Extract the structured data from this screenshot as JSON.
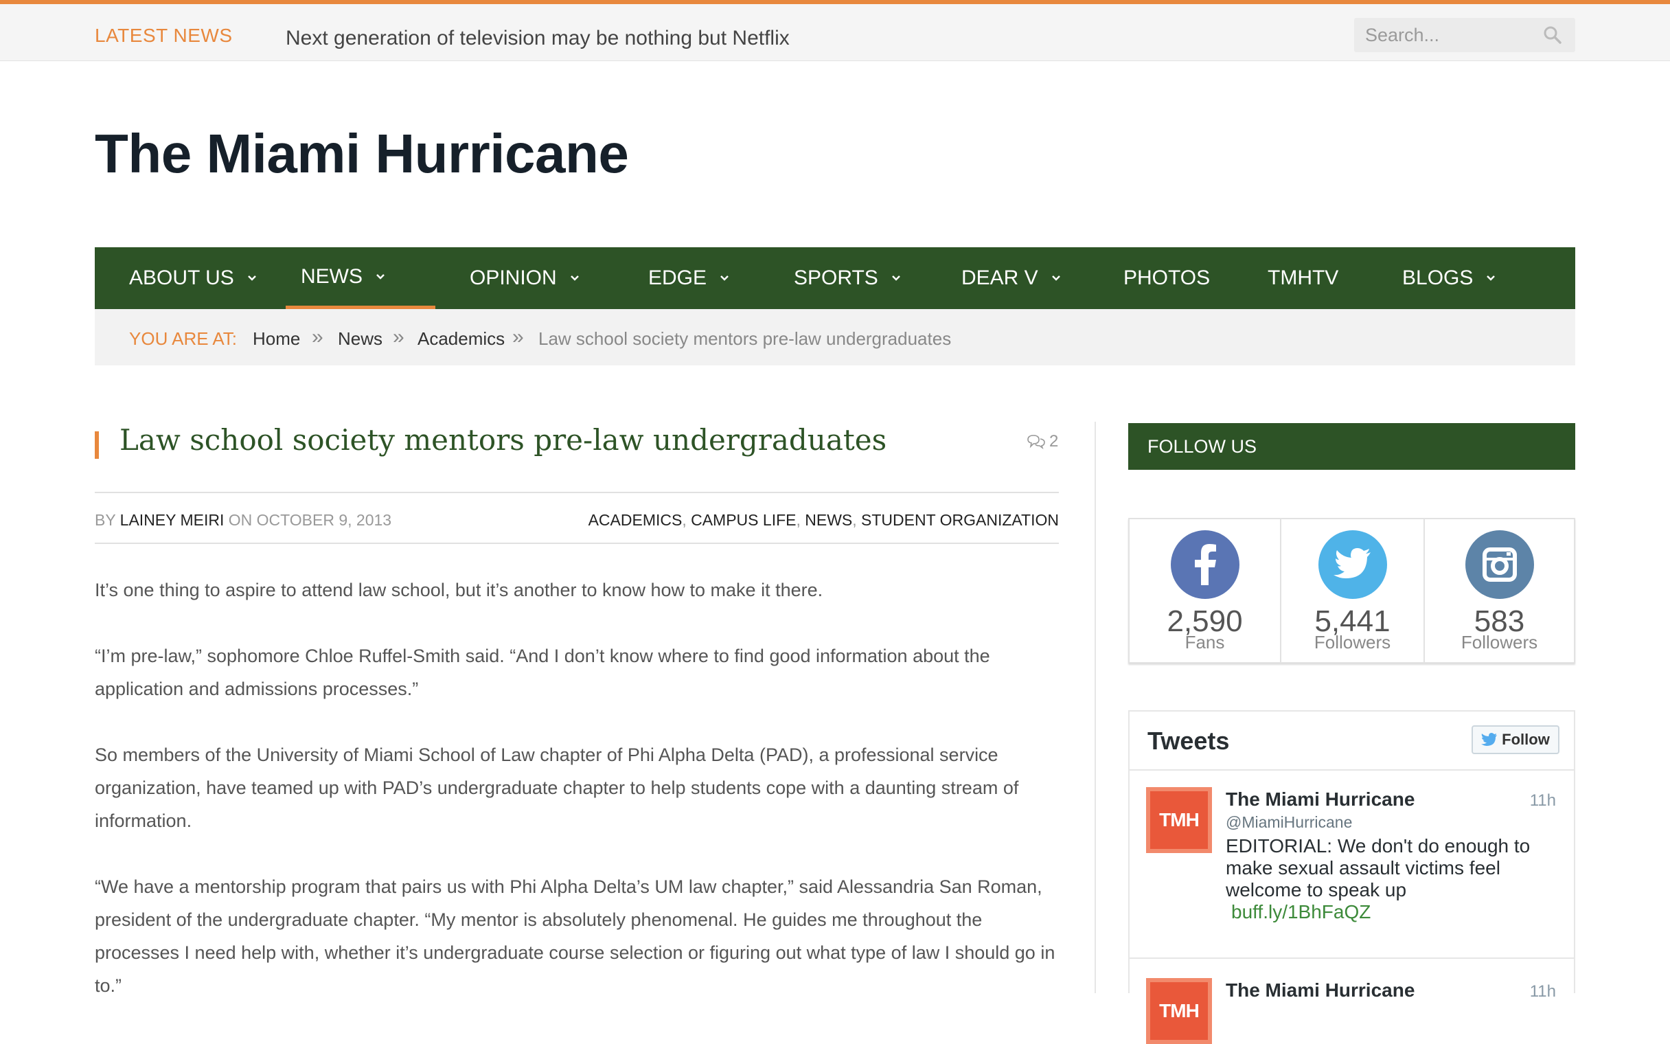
{
  "topbar": {
    "latest_label": "LATEST NEWS",
    "ticker": "Next generation of television may be nothing but Netflix",
    "search_placeholder": "Search..."
  },
  "site_title": "The Miami Hurricane",
  "nav": {
    "items": [
      {
        "label": "ABOUT US",
        "dropdown": true
      },
      {
        "label": "NEWS",
        "dropdown": true,
        "active": true
      },
      {
        "label": "OPINION",
        "dropdown": true
      },
      {
        "label": "EDGE",
        "dropdown": true
      },
      {
        "label": "SPORTS",
        "dropdown": true
      },
      {
        "label": "DEAR V",
        "dropdown": true
      },
      {
        "label": "PHOTOS",
        "dropdown": false
      },
      {
        "label": "TMHTV",
        "dropdown": false
      },
      {
        "label": "BLOGS",
        "dropdown": true
      }
    ]
  },
  "breadcrumb": {
    "prefix": "YOU ARE AT:",
    "items": [
      "Home",
      "News",
      "Academics",
      "Law school society mentors pre-law undergraduates"
    ],
    "separator": "»"
  },
  "article": {
    "title": "Law school society mentors pre-law undergraduates",
    "comment_count": "2",
    "by_label": "BY",
    "author": "LAINEY MEIRI",
    "on_label": "ON",
    "date": "OCTOBER 9, 2013",
    "categories": [
      "ACADEMICS",
      "CAMPUS LIFE",
      "NEWS",
      "STUDENT ORGANIZATION"
    ],
    "paragraphs": [
      "It’s one thing to aspire to attend law school, but it’s another to know how to make it there.",
      "“I’m pre-law,” sophomore Chloe Ruffel-Smith said. “And I don’t know where to find good information about the application and admissions processes.”",
      "So members of the University of Miami School of Law chapter of Phi Alpha Delta (PAD), a professional service organization, have teamed up with PAD’s undergraduate chapter to help students  cope with a daunting stream of information.",
      "“We have a mentorship program that pairs us with Phi Alpha Delta’s UM law chapter,” said Alessandria San Roman, president of the undergraduate chapter. “My mentor is absolutely phenomenal. He guides me throughout the processes I need help with, whether it’s undergraduate course selection or figuring out what type of law I should go in to.”"
    ]
  },
  "sidebar": {
    "follow_heading": "FOLLOW US",
    "social": [
      {
        "network": "facebook",
        "icon": "facebook-icon",
        "count": "2,590",
        "label": "Fans",
        "color": "#5a75b4"
      },
      {
        "network": "twitter",
        "icon": "twitter-icon",
        "count": "5,441",
        "label": "Followers",
        "color": "#4fb3e8"
      },
      {
        "network": "instagram",
        "icon": "instagram-icon",
        "count": "583",
        "label": "Followers",
        "color": "#5d84a8"
      }
    ],
    "tweets": {
      "title": "Tweets",
      "follow_label": "Follow",
      "items": [
        {
          "avatar_text": "TMH",
          "name": "The Miami Hurricane",
          "handle": "@MiamiHurricane",
          "time": "11h",
          "text": "EDITORIAL: We don't do enough to make sexual assault victims feel welcome to speak up",
          "link": "buff.ly/1BhFaQZ"
        },
        {
          "avatar_text": "TMH",
          "name": "The Miami Hurricane",
          "time": "11h"
        }
      ]
    }
  },
  "colors": {
    "accent": "#e8883d",
    "nav_green": "#2d5326",
    "title_green": "#2d5326"
  }
}
